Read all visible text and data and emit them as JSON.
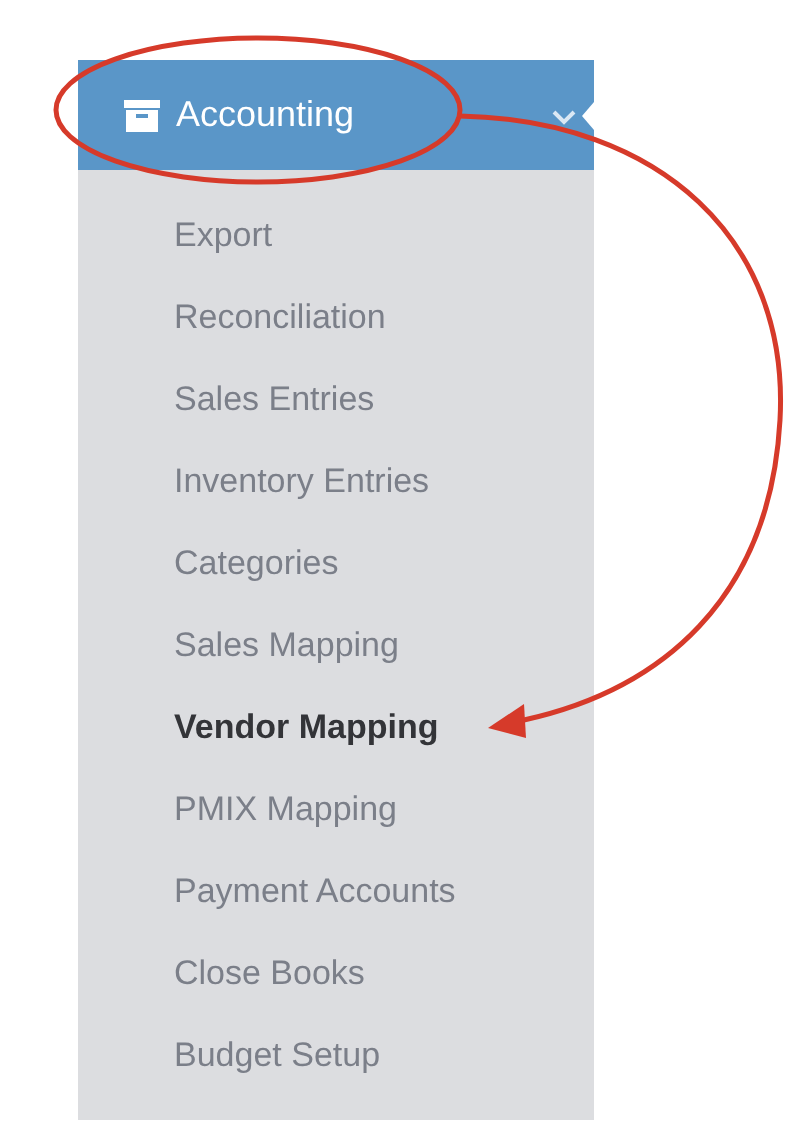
{
  "menu": {
    "title": "Accounting",
    "expanded": true,
    "items": [
      {
        "label": "Export",
        "selected": false
      },
      {
        "label": "Reconciliation",
        "selected": false
      },
      {
        "label": "Sales Entries",
        "selected": false
      },
      {
        "label": "Inventory Entries",
        "selected": false
      },
      {
        "label": "Categories",
        "selected": false
      },
      {
        "label": "Sales Mapping",
        "selected": false
      },
      {
        "label": "Vendor Mapping",
        "selected": true
      },
      {
        "label": "PMIX Mapping",
        "selected": false
      },
      {
        "label": "Payment Accounts",
        "selected": false
      },
      {
        "label": "Close Books",
        "selected": false
      },
      {
        "label": "Budget Setup",
        "selected": false
      }
    ]
  }
}
